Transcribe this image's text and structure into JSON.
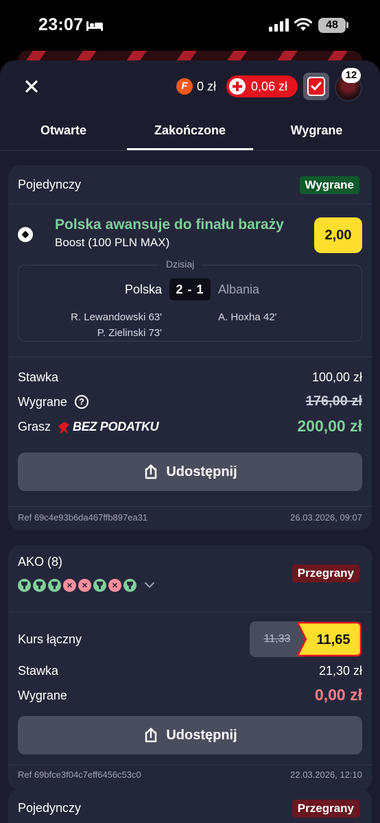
{
  "status_bar": {
    "time": "23:07",
    "battery": "48"
  },
  "header": {
    "coin_amount": "0 zł",
    "cash_amount": "0,06 zł",
    "notification_count": "12"
  },
  "tabs": [
    {
      "label": "Otwarte"
    },
    {
      "label": "Zakończone",
      "active": true
    },
    {
      "label": "Wygrane"
    }
  ],
  "bet1": {
    "type": "Pojedynczy",
    "status": "Wygrane",
    "selection": "Polska awansuje do finału baraży",
    "market": "Boost (100 PLN MAX)",
    "odds": "2,00",
    "date_label": "Dzisiaj",
    "home": "Polska",
    "away": "Albania",
    "score": "2 - 1",
    "home_scorers": [
      "R. Lewandowski 63'",
      "P. Zielinski 73'"
    ],
    "away_scorers": [
      "A. Hoxha 42'"
    ],
    "stake_label": "Stawka",
    "stake": "100,00 zł",
    "win_label": "Wygrane",
    "win_original": "176,00 zł",
    "tax_label": "Grasz",
    "tax_brand": "BEZ PODATKU",
    "win_final": "200,00 zł",
    "share_label": "Udostępnij",
    "ref": "Ref 69c4e93b6da467ffb897ea31",
    "placed": "26.03.2026, 09:07"
  },
  "bet2": {
    "type": "AKO (8)",
    "status": "Przegrany",
    "legs": [
      "won",
      "won",
      "won",
      "lost",
      "lost",
      "won",
      "lost",
      "won"
    ],
    "total_odds_label": "Kurs łączny",
    "odds_old": "11,33",
    "odds_new": "11,65",
    "stake_label": "Stawka",
    "stake": "21,30 zł",
    "win_label": "Wygrane",
    "win": "0,00 zł",
    "share_label": "Udostępnij",
    "ref": "Ref 69bfce3f04c7eff6456c53c0",
    "placed": "22.03.2026, 12:10"
  },
  "bet3": {
    "type": "Pojedynczy",
    "status": "Przegrany"
  },
  "colors": {
    "sheet_bg": "#1b1d2e",
    "card_bg": "#24273a",
    "accent_red": "#e3141f",
    "odds_yellow": "#ffde2e",
    "win_green": "#7fd09a",
    "loss_pink": "#ff7f8c"
  }
}
